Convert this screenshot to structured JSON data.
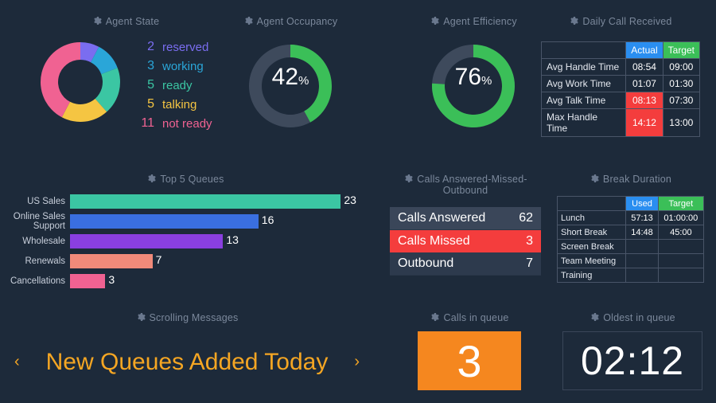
{
  "chart_data": [
    {
      "id": "agent_state_donut",
      "type": "pie",
      "title": "Agent State",
      "categories": [
        "reserved",
        "working",
        "ready",
        "talking",
        "not ready"
      ],
      "values": [
        2,
        3,
        5,
        5,
        11
      ],
      "colors": [
        "#7a6df0",
        "#2aa6d8",
        "#3bc6a3",
        "#f5c542",
        "#f06292"
      ]
    },
    {
      "id": "agent_occupancy_gauge",
      "type": "pie",
      "title": "Agent Occupancy",
      "value_pct": 42,
      "color": "#3bbf58",
      "track_color": "#3e4a5c"
    },
    {
      "id": "agent_efficiency_gauge",
      "type": "pie",
      "title": "Agent Efficiency",
      "value_pct": 76,
      "color": "#3bbf58",
      "track_color": "#3e4a5c"
    },
    {
      "id": "top5_queues_bar",
      "type": "bar",
      "title": "Top 5 Queues",
      "orientation": "horizontal",
      "categories": [
        "US Sales",
        "Online Sales Support",
        "Wholesale",
        "Renewals",
        "Cancellations"
      ],
      "values": [
        23,
        16,
        13,
        7,
        3
      ],
      "colors": [
        "#3bc6a3",
        "#3a6fe0",
        "#8a3fe0",
        "#f08a7a",
        "#f06292"
      ],
      "xlim": [
        0,
        25
      ]
    }
  ],
  "agent_state": {
    "title": "Agent State",
    "legend": [
      {
        "n": "2",
        "label": "reserved",
        "color": "#7a6df0"
      },
      {
        "n": "3",
        "label": "working",
        "color": "#2aa6d8"
      },
      {
        "n": "5",
        "label": "ready",
        "color": "#3bc6a3"
      },
      {
        "n": "5",
        "label": "talking",
        "color": "#f5c542"
      },
      {
        "n": "11",
        "label": "not ready",
        "color": "#f06292"
      }
    ]
  },
  "occupancy": {
    "title": "Agent Occupancy",
    "value": "42",
    "pct": "%"
  },
  "efficiency": {
    "title": "Agent Efficiency",
    "value": "76",
    "pct": "%"
  },
  "daily": {
    "title": "Daily Call Received",
    "headers": {
      "actual": "Actual",
      "target": "Target"
    },
    "rows": [
      {
        "label": "Avg Handle Time",
        "actual": "08:54",
        "target": "09:00",
        "actual_red": false
      },
      {
        "label": "Avg Work Time",
        "actual": "01:07",
        "target": "01:30",
        "actual_red": false
      },
      {
        "label": "Avg Talk Time",
        "actual": "08:13",
        "target": "07:30",
        "actual_red": true
      },
      {
        "label": "Max Handle Time",
        "actual": "14:12",
        "target": "13:00",
        "actual_red": true
      }
    ]
  },
  "top5": {
    "title": "Top 5 Queues",
    "max": 25,
    "rows": [
      {
        "label": "US Sales",
        "value": 23,
        "color": "#3bc6a3"
      },
      {
        "label": "Online Sales Support",
        "value": 16,
        "color": "#3a6fe0"
      },
      {
        "label": "Wholesale",
        "value": 13,
        "color": "#8a3fe0"
      },
      {
        "label": "Renewals",
        "value": 7,
        "color": "#f08a7a"
      },
      {
        "label": "Cancellations",
        "value": 3,
        "color": "#f06292"
      }
    ]
  },
  "amo": {
    "title": "Calls Answered-Missed-Outbound",
    "rows": [
      {
        "label": "Calls Answered",
        "value": "62",
        "style": "first"
      },
      {
        "label": "Calls Missed",
        "value": "3",
        "style": "red"
      },
      {
        "label": "Outbound",
        "value": "7",
        "style": "last"
      }
    ]
  },
  "break": {
    "title": "Break Duration",
    "headers": {
      "used": "Used",
      "target": "Target"
    },
    "rows": [
      {
        "label": "Lunch",
        "used": "57:13",
        "target": "01:00:00"
      },
      {
        "label": "Short Break",
        "used": "14:48",
        "target": "45:00"
      },
      {
        "label": "Screen Break",
        "used": "",
        "target": ""
      },
      {
        "label": "Team Meeting",
        "used": "",
        "target": ""
      },
      {
        "label": "Training",
        "used": "",
        "target": ""
      }
    ]
  },
  "scroll": {
    "title": "Scrolling Messages",
    "text": "New Queues Added Today"
  },
  "ciq": {
    "title": "Calls in queue",
    "value": "3"
  },
  "oiq": {
    "title": "Oldest in queue",
    "value": "02:12"
  }
}
